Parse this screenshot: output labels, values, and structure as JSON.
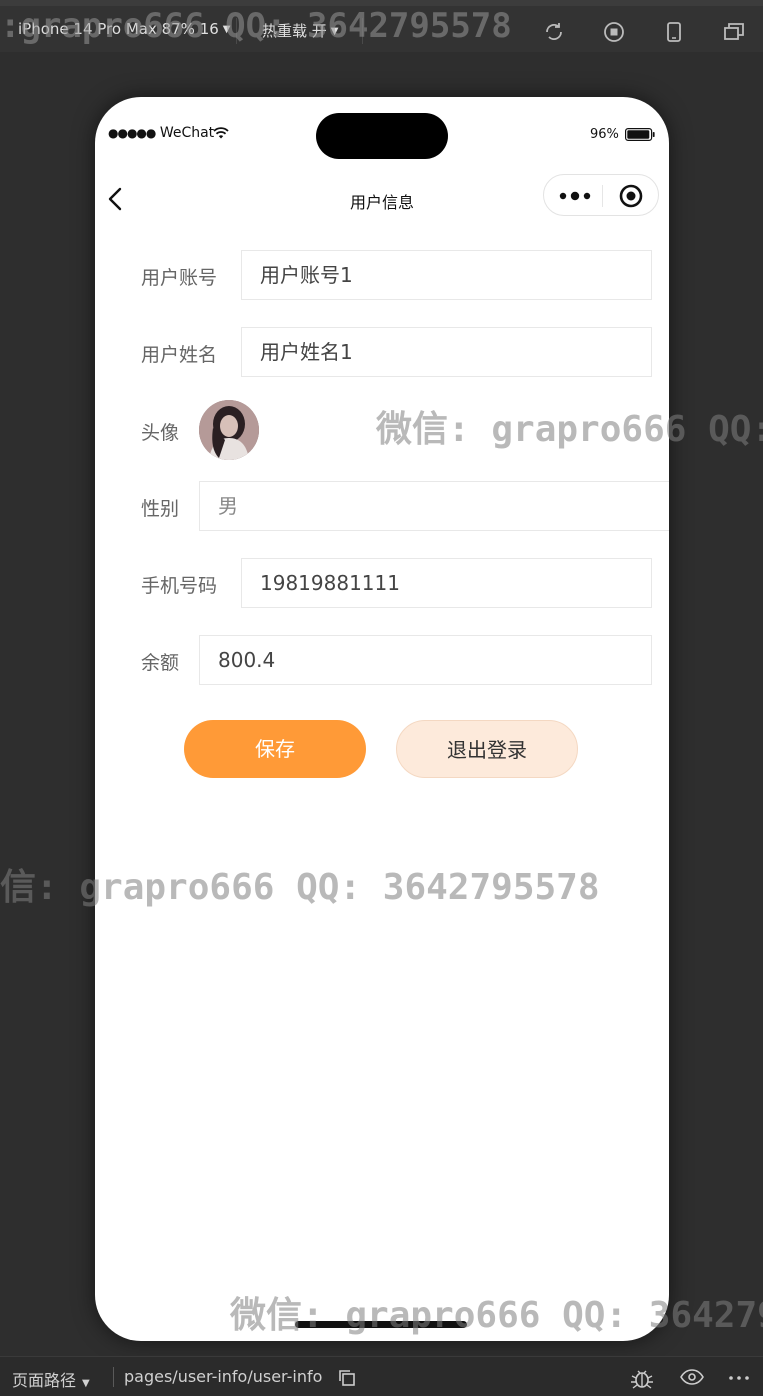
{
  "toolbar": {
    "device": "iPhone 14 Pro Max 87% 16",
    "hot_reload": "热重载 开",
    "icons": [
      "refresh-icon",
      "record-icon",
      "phone-icon",
      "window-icon"
    ]
  },
  "status_bar": {
    "carrier": "WeChat",
    "battery": "96%"
  },
  "nav": {
    "title": "用户信息"
  },
  "form": {
    "account": {
      "label": "用户账号",
      "value": "用户账号1"
    },
    "name": {
      "label": "用户姓名",
      "value": "用户姓名1"
    },
    "avatar": {
      "label": "头像"
    },
    "gender": {
      "label": "性别",
      "value": "男"
    },
    "phone": {
      "label": "手机号码",
      "value": "19819881111"
    },
    "balance": {
      "label": "余额",
      "value": "800.4"
    }
  },
  "buttons": {
    "save": "保存",
    "logout": "退出登录"
  },
  "watermarks": {
    "top": ":grapro666 QQ: 3642795578",
    "middle_right": "微信: grapro666 QQ:",
    "middle_left": "信: grapro666 QQ: 3642795578",
    "bottom": "微信: grapro666 QQ: 364279"
  },
  "bottom_bar": {
    "path_label": "页面路径",
    "path_value": "pages/user-info/user-info"
  },
  "colors": {
    "accent": "#ff9a37",
    "logout_bg": "#fdeadb",
    "background": "#2e2e2e"
  }
}
